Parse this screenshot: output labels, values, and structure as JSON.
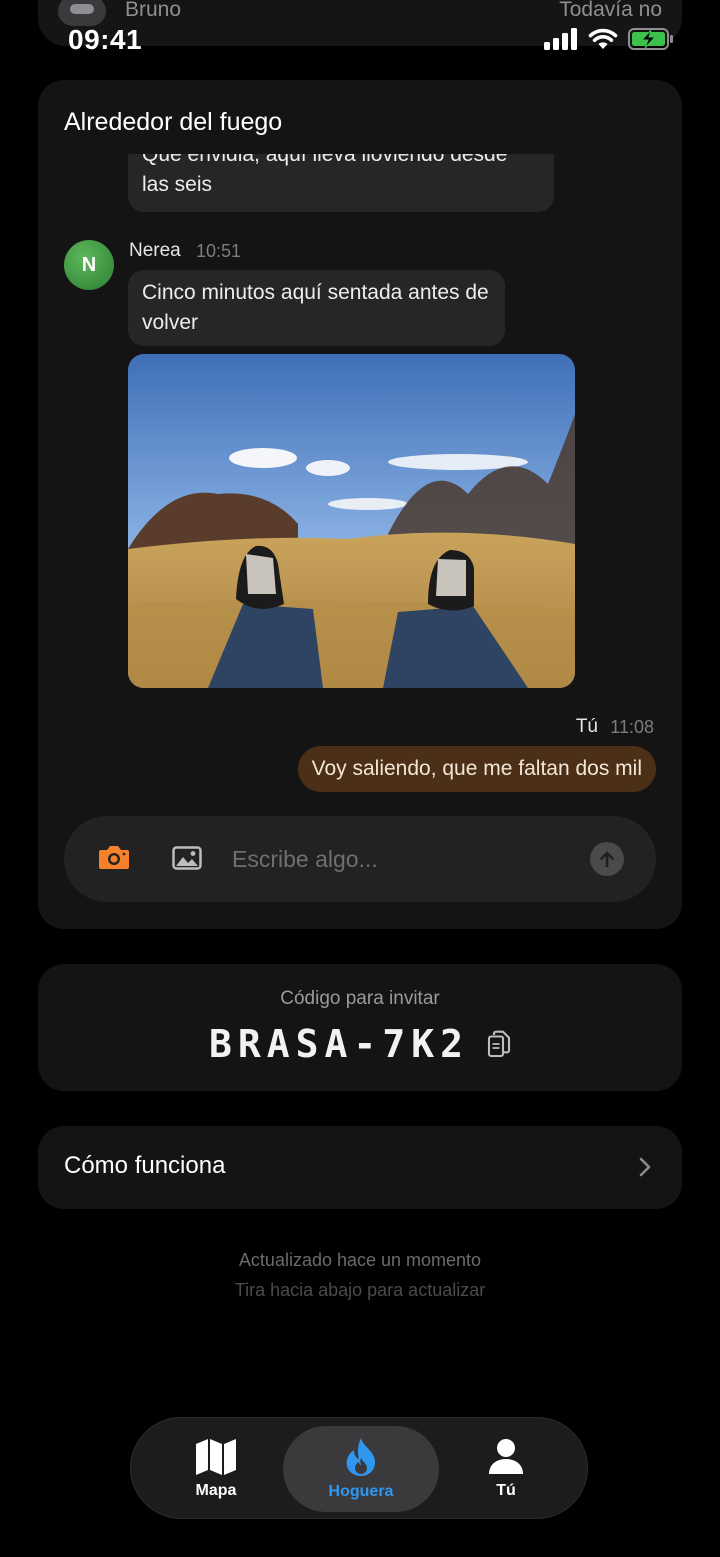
{
  "status_bar": {
    "time": "09:41",
    "behind_card": {
      "name": "Bruno",
      "status": "Todavía no"
    }
  },
  "chat": {
    "title": "Alrededor del fuego",
    "messages": [
      {
        "text": "Que envidia, aquí lleva lloviendo desde las seis"
      },
      {
        "sender": "Nerea",
        "avatar_initial": "N",
        "time": "10:51",
        "text": "Cinco minutos aquí sentada antes de volver",
        "has_photo": true
      },
      {
        "sender": "Tú",
        "time": "11:08",
        "text": "Voy saliendo, que me faltan dos mil"
      }
    ],
    "composer": {
      "placeholder": "Escribe algo...",
      "camera_icon": "camera-icon",
      "gallery_icon": "image-icon",
      "send_icon": "arrow-up-icon"
    }
  },
  "invite": {
    "label": "Código para invitar",
    "code": "BRASA-7K2",
    "copy_icon": "copy-icon"
  },
  "how_it_works": {
    "label": "Cómo funciona",
    "icon": "chevron-right-icon"
  },
  "footer": {
    "updated": "Actualizado hace un momento",
    "hint": "Tira hacia abajo para actualizar"
  },
  "tabs": [
    {
      "label": "Mapa",
      "icon": "map-icon",
      "active": false
    },
    {
      "label": "Hoguera",
      "icon": "flame-icon",
      "active": true
    },
    {
      "label": "Tú",
      "icon": "person-icon",
      "active": false
    }
  ],
  "colors": {
    "background": "#000000",
    "card": "#141414",
    "incoming_bubble": "#262626",
    "outgoing_bubble": "#4b3017",
    "accent_blue": "#2f97f0",
    "camera_orange": "#f5822a",
    "avatar_green": "#3f9a3f"
  }
}
